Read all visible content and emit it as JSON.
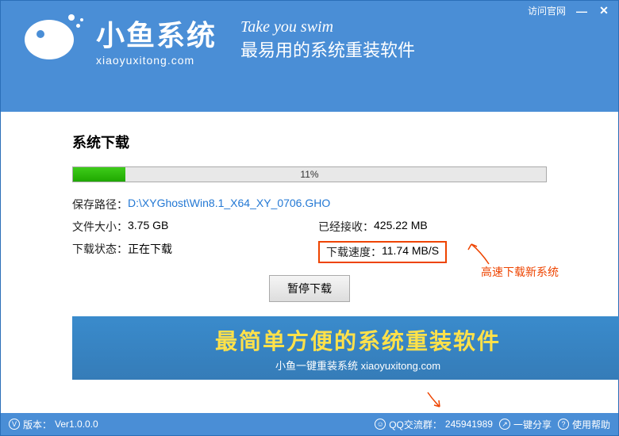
{
  "titlebar": {
    "visit_site": "访问官网"
  },
  "logo": {
    "cn": "小鱼系统",
    "en": "xiaoyuxitong.com"
  },
  "slogan": {
    "en": "Take you swim",
    "cn": "最易用的系统重装软件"
  },
  "section_title": "系统下载",
  "progress": {
    "percent_text": "11%"
  },
  "info": {
    "path_label": "保存路径：",
    "path_value": "D:\\XYGhost\\Win8.1_X64_XY_0706.GHO",
    "size_label": "文件大小：",
    "size_value": "3.75 GB",
    "received_label": "已经接收：",
    "received_value": "425.22 MB",
    "status_label": "下载状态：",
    "status_value": "正在下载",
    "speed_label": "下载速度：",
    "speed_value": "11.74 MB/S"
  },
  "pause_label": "暂停下载",
  "annotation": {
    "speed_note": "高速下载新系统"
  },
  "banner": {
    "main": "最简单方便的系统重装软件",
    "sub": "小鱼一键重装系统 xiaoyuxitong.com"
  },
  "footer": {
    "version_label": "版本：",
    "version_value": "Ver1.0.0.0",
    "qq_label": "QQ交流群：",
    "qq_value": "245941989",
    "share": "一键分享",
    "help": "使用帮助"
  }
}
